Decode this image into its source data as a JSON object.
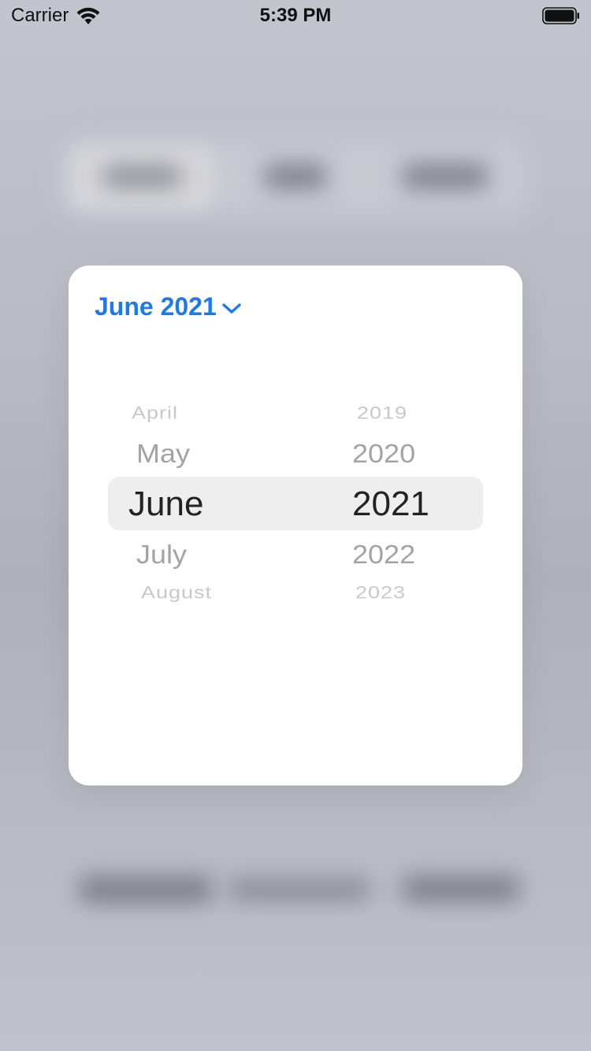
{
  "status_bar": {
    "carrier": "Carrier",
    "time": "5:39 PM"
  },
  "popover": {
    "header_label": "June 2021",
    "accent_color": "#1f7ae6"
  },
  "picker": {
    "months": [
      "April",
      "May",
      "June",
      "July",
      "August"
    ],
    "years": [
      "2019",
      "2020",
      "2021",
      "2022",
      "2023"
    ],
    "selected_month": "June",
    "selected_year": "2021"
  },
  "icons": {
    "wifi": "wifi-icon",
    "battery": "battery-icon",
    "chevron": "chevron-down-icon"
  }
}
